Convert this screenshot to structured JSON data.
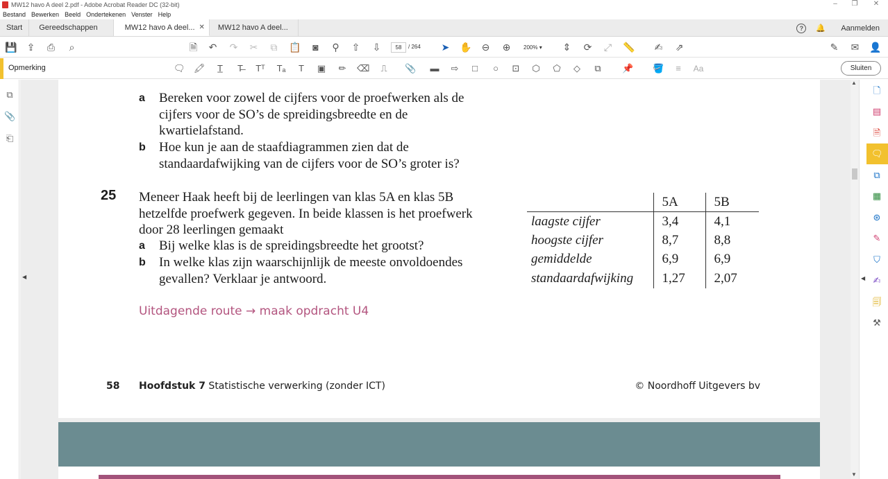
{
  "window": {
    "title": "MW12 havo A deel 2.pdf - Adobe Acrobat Reader DC (32-bit)"
  },
  "menu": [
    "Bestand",
    "Bewerken",
    "Beeld",
    "Ondertekenen",
    "Venster",
    "Help"
  ],
  "tabs": {
    "home": "Start",
    "tools": "Gereedschappen",
    "doc1": "MW12 havo A deel...",
    "doc2": "MW12 havo A deel..."
  },
  "header_right": {
    "login": "Aanmelden"
  },
  "toolbar": {
    "page_current": "58",
    "page_total": "/ 264",
    "zoom": "200%"
  },
  "comment_bar": {
    "label": "Opmerking",
    "close": "Sluiten"
  },
  "document": {
    "q24": {
      "a_label": "a",
      "a_lines": [
        "Bereken voor zowel de cijfers voor de proefwerken als de",
        "cijfers voor de SO’s de spreidingsbreedte en de",
        "kwartielafstand."
      ],
      "b_label": "b",
      "b_lines": [
        "Hoe kun je aan de staafdiagrammen zien dat de",
        "standaardafwijking van de cijfers voor de SO’s groter is?"
      ]
    },
    "q25": {
      "number": "25",
      "intro_lines": [
        "Meneer Haak heeft bij de leerlingen van klas 5A en klas 5B",
        "hetzelfde proefwerk gegeven. In beide klassen is het proefwerk",
        "door 28 leerlingen gemaakt"
      ],
      "a_label": "a",
      "a_text": "Bij welke klas is de spreidingsbreedte het grootst?",
      "b_label": "b",
      "b_lines": [
        "In welke klas zijn waarschijnlijk de meeste onvoldoendes",
        "gevallen? Verklaar je antwoord."
      ]
    },
    "table": {
      "headers": [
        "5A",
        "5B"
      ],
      "rows": [
        {
          "label": "laagste cijfer",
          "a": "3,4",
          "b": "4,1"
        },
        {
          "label": "hoogste cijfer",
          "a": "8,7",
          "b": "8,8"
        },
        {
          "label": "gemiddelde",
          "a": "6,9",
          "b": "6,9"
        },
        {
          "label": "standaardafwijking",
          "a": "1,27",
          "b": "2,07"
        }
      ]
    },
    "challenge": "Uitdagende route → maak opdracht U4",
    "footer": {
      "page": "58",
      "chapter_bold": "Hoofdstuk 7",
      "chapter_rest": " Statistische verwerking (zonder ICT)",
      "copyright": "© Noordhoff Uitgevers bv"
    }
  },
  "colors": {
    "accent_yellow": "#f2c12e",
    "challenge_pink": "#b3557f",
    "teal_band": "#6b8c91"
  }
}
